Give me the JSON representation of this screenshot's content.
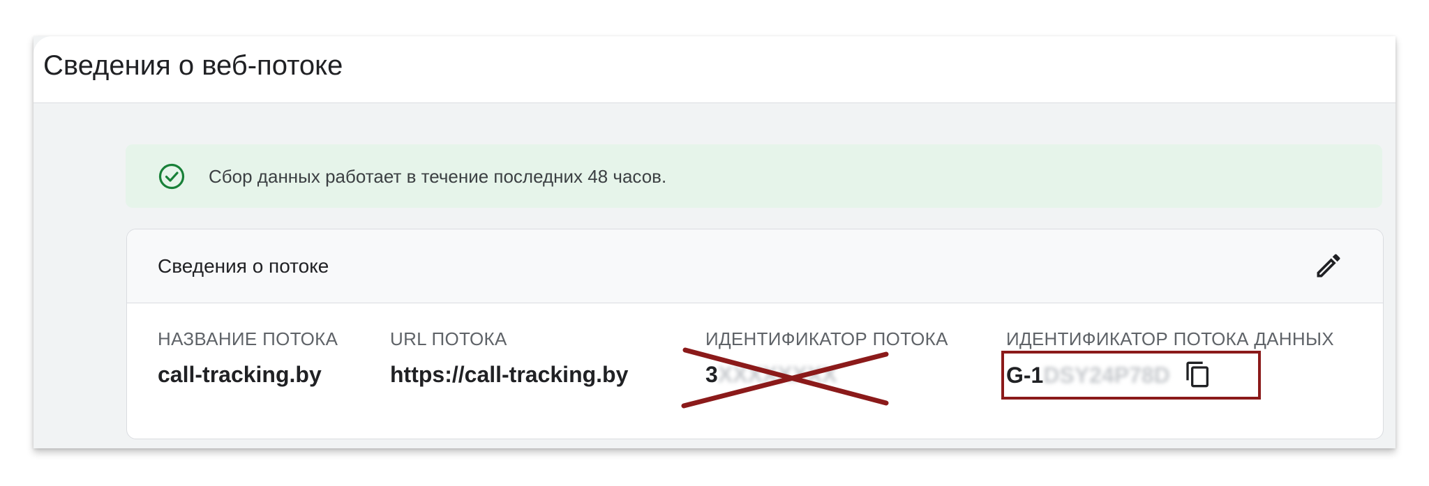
{
  "header": {
    "title": "Сведения о веб-потоке"
  },
  "status": {
    "icon": "check-circle-icon",
    "text": "Сбор данных работает в течение последних 48 часов.",
    "color": "#188038",
    "background": "#e6f4ea"
  },
  "card": {
    "title": "Сведения о потоке",
    "edit_icon": "pencil-icon",
    "fields": [
      {
        "label": "НАЗВАНИЕ ПОТОКА",
        "value": "call-tracking.by"
      },
      {
        "label": "URL ПОТОКА",
        "value": "https://call-tracking.by"
      },
      {
        "label": "ИДЕНТИФИКАТОР ПОТОКА",
        "value": "3",
        "value_obscured": "XXXXXXXX"
      },
      {
        "label": "ИДЕНТИФИКАТОР ПОТОКА ДАННЫХ",
        "value": "G-1",
        "value_obscured": "DSY24P78D",
        "copy_icon": "copy-icon"
      }
    ]
  },
  "annotations": {
    "highlight_color": "#8b1a1a"
  }
}
